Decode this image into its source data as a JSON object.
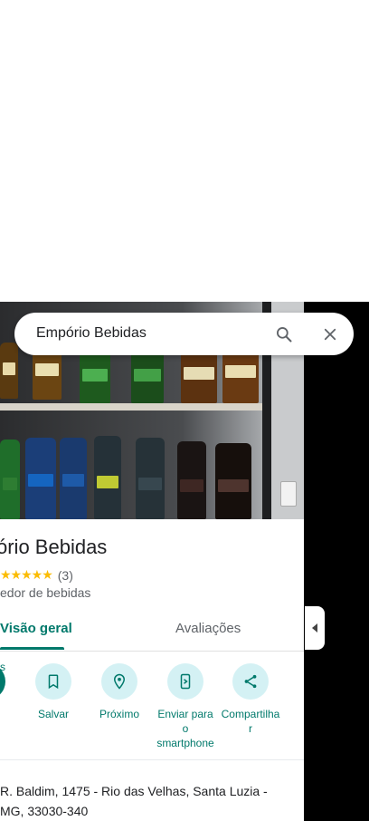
{
  "search": {
    "query": "Empório Bebidas"
  },
  "place": {
    "name_visible": "ório Bebidas",
    "rating_count": "(3)",
    "stars": "★★★★★",
    "category_visible": "edor de bebidas"
  },
  "tabs": [
    {
      "label": "Visão geral"
    },
    {
      "label": "Avaliações"
    }
  ],
  "actions": {
    "first_label_visible": "s",
    "items": [
      {
        "label": "Salvar",
        "icon": "bookmark-icon"
      },
      {
        "label": "Próximo",
        "icon": "nearby-icon"
      },
      {
        "label": "Enviar para o smartphone",
        "label_lines": [
          "Enviar para",
          "o",
          "smartphone"
        ],
        "icon": "send-to-phone-icon"
      },
      {
        "label": "Compartilhar",
        "label_lines": [
          "Compartilha",
          "r"
        ],
        "icon": "share-icon"
      }
    ]
  },
  "address": {
    "line1": "R. Baldim, 1475 - Rio das Velhas, Santa Luzia -",
    "line2": "MG, 33030-340"
  },
  "colors": {
    "accent": "#00796b",
    "action_bg": "#d4f1f4",
    "star": "#fbbc04"
  }
}
